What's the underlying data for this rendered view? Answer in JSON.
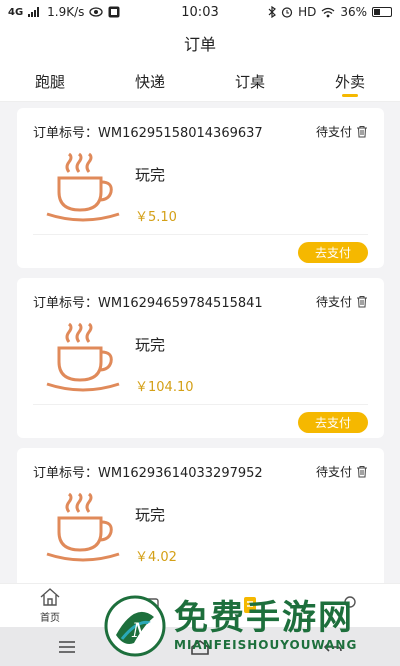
{
  "status_bar": {
    "network": "4G",
    "speed": "1.9K/s",
    "time": "10:03",
    "hd": "HD",
    "battery": "36%"
  },
  "header": {
    "title": "订单"
  },
  "tabs": [
    {
      "label": "跑腿",
      "active": false
    },
    {
      "label": "快递",
      "active": false
    },
    {
      "label": "订桌",
      "active": false
    },
    {
      "label": "外卖",
      "active": true
    }
  ],
  "orders": [
    {
      "number": "订单标号：WM16295158014369637",
      "status": "待支付",
      "item": "玩完",
      "price": "￥5.10",
      "action": "去支付"
    },
    {
      "number": "订单标号：WM16294659784515841",
      "status": "待支付",
      "item": "玩完",
      "price": "￥104.10",
      "action": "去支付"
    },
    {
      "number": "订单标号：WM16293614033297952",
      "status": "待支付",
      "item": "玩完",
      "price": "￥4.02",
      "action": ""
    }
  ],
  "bottom_nav": [
    {
      "label": "首页",
      "icon": "home-icon"
    },
    {
      "label": "",
      "icon": "message-icon"
    },
    {
      "label": "",
      "icon": "order-icon"
    },
    {
      "label": "",
      "icon": "profile-icon"
    }
  ],
  "watermark": {
    "cn": "免费手游网",
    "en": "MIANFEISHOUYOUWANG",
    "logo_letter": "M"
  },
  "colors": {
    "accent": "#f5b800",
    "price": "#d4a017",
    "cup": "#e08a5a",
    "watermark": "#1d6f3c"
  }
}
